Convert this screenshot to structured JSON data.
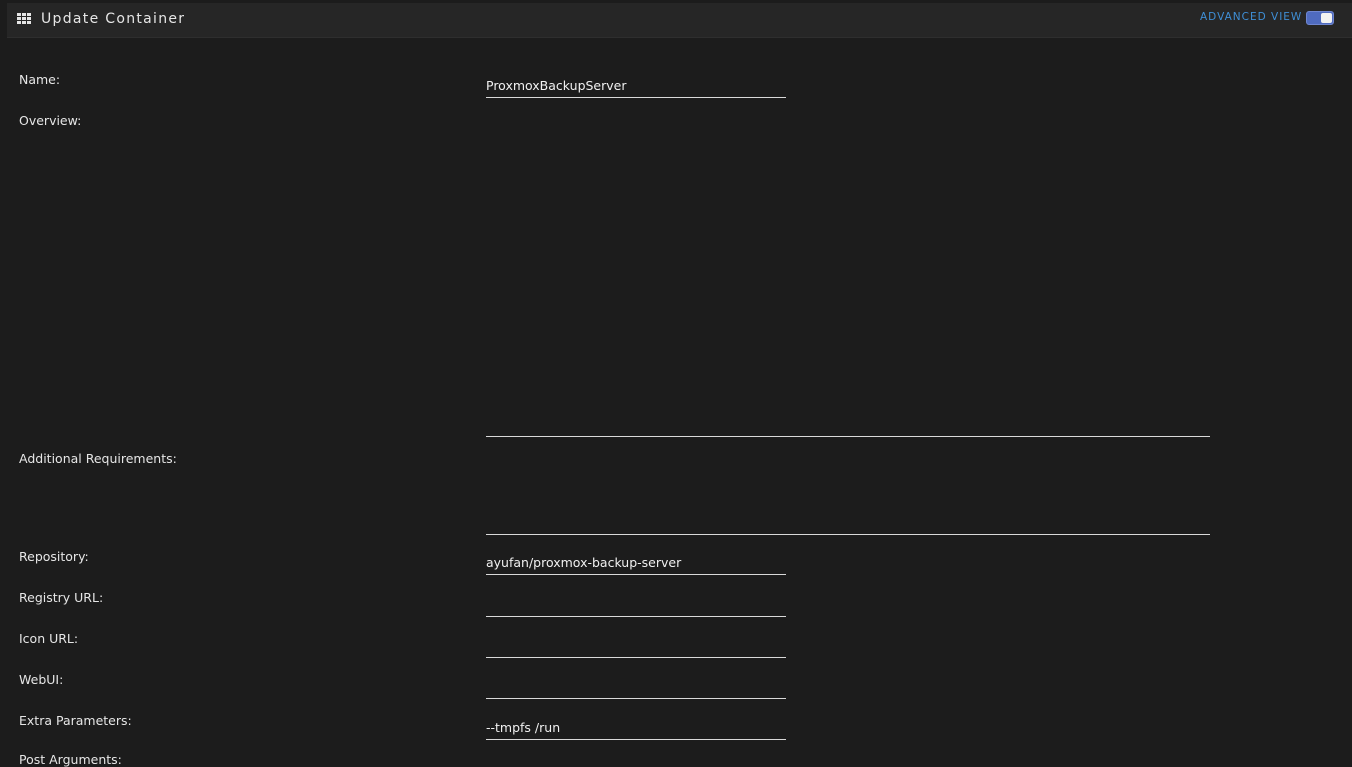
{
  "header": {
    "title": "Update Container",
    "advanced_view_label": "ADVANCED VIEW",
    "advanced_view_enabled": true,
    "menu_icon": "grid-icon"
  },
  "form": {
    "name": {
      "label": "Name:",
      "value": "ProxmoxBackupServer"
    },
    "overview": {
      "label": "Overview:",
      "value": ""
    },
    "additional_requirements": {
      "label": "Additional Requirements:",
      "value": ""
    },
    "repository": {
      "label": "Repository:",
      "value": "ayufan/proxmox-backup-server"
    },
    "registry_url": {
      "label": "Registry URL:",
      "value": ""
    },
    "icon_url": {
      "label": "Icon URL:",
      "value": ""
    },
    "webui": {
      "label": "WebUI:",
      "value": ""
    },
    "extra_parameters": {
      "label": "Extra Parameters:",
      "value": "--tmpfs /run"
    },
    "post_arguments": {
      "label": "Post Arguments:"
    }
  },
  "colors": {
    "background": "#1c1c1c",
    "header": "#262626",
    "accent": "#3f8fd6",
    "toggle": "#4f6bbf"
  }
}
